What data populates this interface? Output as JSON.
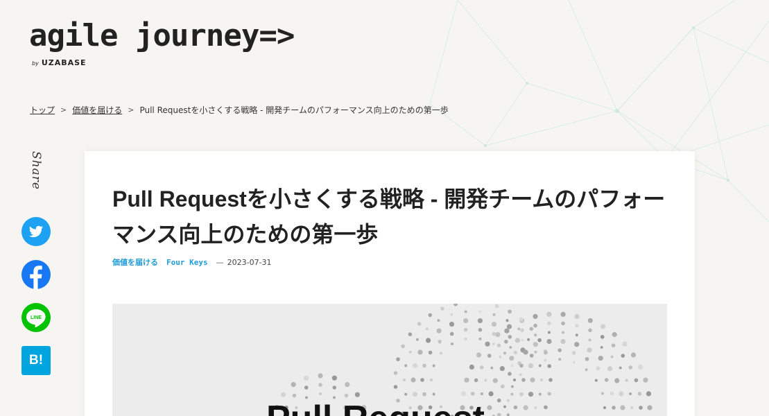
{
  "site": {
    "logo_text": "agile journey=>",
    "by_label": "by",
    "brand": "UZABASE"
  },
  "breadcrumb": {
    "items": [
      "トップ",
      "価値を届ける"
    ],
    "separator": ">",
    "current": "Pull Requestを小さくする戦略 - 開発チームのパフォーマンス向上のための第一歩"
  },
  "share": {
    "label": "Share",
    "hatena_label": "B!",
    "line_label": "LINE"
  },
  "article": {
    "title": "Pull Requestを小さくする戦略 - 開発チームのパフォーマンス向上のための第一歩",
    "tags": [
      "価値を届ける",
      "Four Keys"
    ],
    "dash": "—",
    "date": "2023-07-31",
    "hero_text": "Pull Request"
  },
  "colors": {
    "accent": "#1f9bd6",
    "twitter": "#1da1f2",
    "facebook": "#1877f2",
    "line": "#00c300",
    "hatena": "#00a4de"
  }
}
